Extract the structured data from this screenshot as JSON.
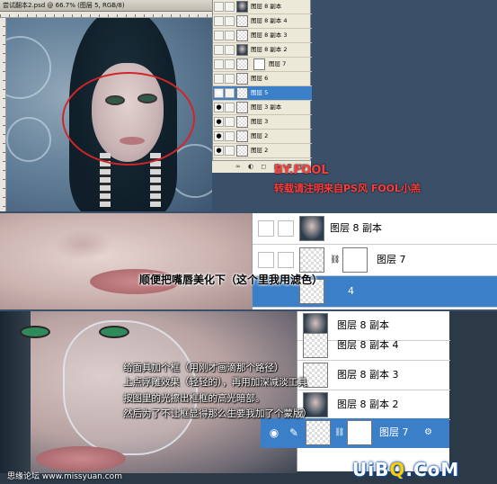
{
  "ps_window": {
    "title": "尝试翻本2.psd @ 66.7% (图层 5, RGB/8)"
  },
  "layers_panel_1": {
    "rows": [
      {
        "name": "图层 8 副本"
      },
      {
        "name": "图层 8 副本 4"
      },
      {
        "name": "图层 8 副本 3"
      },
      {
        "name": "图层 8 副本 2"
      },
      {
        "name": "图层 7"
      },
      {
        "name": "图层 6"
      },
      {
        "name": "图层 5"
      },
      {
        "name": "图层 3 副本"
      },
      {
        "name": "图层 3"
      },
      {
        "name": "图层 2"
      },
      {
        "name": "图层 2"
      }
    ],
    "bottom_icons": "∞ ◐ ◻ ▢ ⊞ ▤"
  },
  "watermark": {
    "title": "BY.FOOL",
    "note": "转载请注明来自PS风 FOOL小羔"
  },
  "section2": {
    "caption": "顺便把嘴唇美化下（这个里我用滤色）",
    "rows": [
      {
        "name": "图层 8 副本"
      },
      {
        "name": "图层 7"
      }
    ],
    "selected_label": "4"
  },
  "section3": {
    "captions": [
      "给面具加个框（用刚才画滴那个路径）",
      "上点浮雕效果（轻轻的），再用加深减淡工具",
      "按图里的光擦出框框的高光暗部。",
      "然后为了不让框显得那么生要我加了个蒙版）"
    ],
    "rows": [
      {
        "name": "图层 8 副本"
      },
      {
        "name": "图层 8 副本 4"
      },
      {
        "name": "图层 8 副本 3"
      },
      {
        "name": "图层 8 副本 2"
      }
    ],
    "selected_row": {
      "name": "图层 7"
    }
  },
  "footer": {
    "site": "思缘论坛 www.missyuan.com",
    "logo_prefix": "UiB",
    "logo_q": "Q",
    "logo_suffix": ".CoM"
  },
  "colors": {
    "selection_blue": "#3a7fc8",
    "annotation_red": "#d0262a",
    "watermark_red": "#ff3c3c"
  }
}
